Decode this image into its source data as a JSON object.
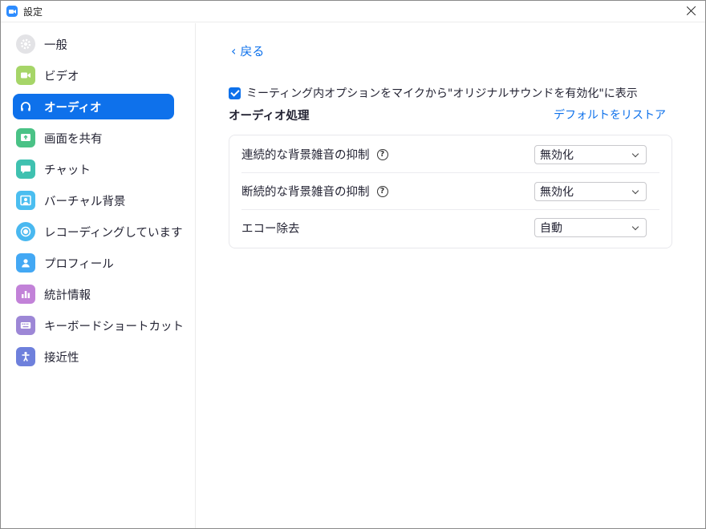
{
  "window": {
    "title": "設定"
  },
  "sidebar": {
    "items": [
      {
        "label": "一般",
        "icon": "gear-icon",
        "color": "#e3e3e6",
        "active": false
      },
      {
        "label": "ビデオ",
        "icon": "video-camera-icon",
        "color": "#a6d568",
        "active": false
      },
      {
        "label": "オーディオ",
        "icon": "headphones-icon",
        "color": "#0e71eb",
        "active": true
      },
      {
        "label": "画面を共有",
        "icon": "share-screen-icon",
        "color": "#4ac286",
        "active": false
      },
      {
        "label": "チャット",
        "icon": "chat-bubble-icon",
        "color": "#3fc1b0",
        "active": false
      },
      {
        "label": "バーチャル背景",
        "icon": "virtual-background-icon",
        "color": "#4bbef0",
        "active": false
      },
      {
        "label": "レコーディングしています",
        "icon": "record-icon",
        "color": "#49b8f0",
        "active": false
      },
      {
        "label": "プロフィール",
        "icon": "profile-icon",
        "color": "#43a8f4",
        "active": false
      },
      {
        "label": "統計情報",
        "icon": "statistics-icon",
        "color": "#c282d8",
        "active": false
      },
      {
        "label": "キーボードショートカット",
        "icon": "keyboard-icon",
        "color": "#9d87d6",
        "active": false
      },
      {
        "label": "接近性",
        "icon": "accessibility-icon",
        "color": "#6e80dc",
        "active": false
      }
    ]
  },
  "content": {
    "back_label": "戻る",
    "original_sound_option": "ミーティング内オプションをマイクから\"オリジナルサウンドを有効化\"に表示",
    "original_sound_checked": true,
    "section_title": "オーディオ処理",
    "restore_defaults": "デフォルトをリストア",
    "rows": [
      {
        "label": "連続的な背景雑音の抑制",
        "help": true,
        "value": "無効化"
      },
      {
        "label": "断続的な背景雑音の抑制",
        "help": true,
        "value": "無効化"
      },
      {
        "label": "エコー除去",
        "help": false,
        "value": "自動"
      }
    ]
  },
  "colors": {
    "accent": "#0e71eb",
    "text": "#232333"
  }
}
